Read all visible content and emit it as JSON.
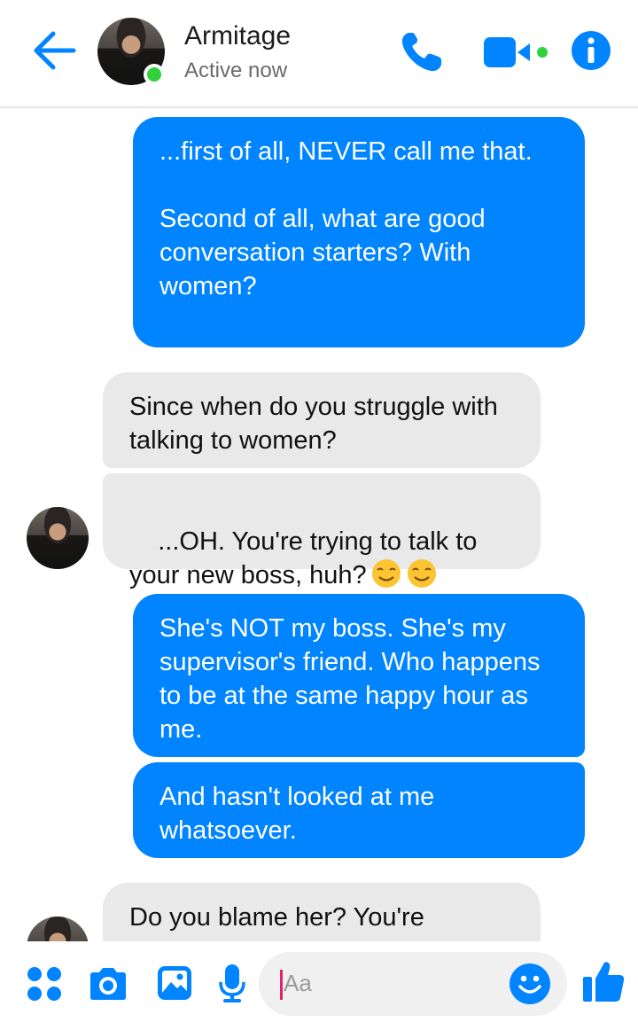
{
  "header": {
    "name": "Armitage",
    "status": "Active now"
  },
  "messages": [
    {
      "side": "out",
      "text": "...first of all, NEVER call me that.\n\nSecond of all, what are good conversation starters? With women?"
    },
    {
      "side": "in",
      "text": "Since when do you struggle with talking to women?"
    },
    {
      "side": "in",
      "text": "...OH. You're trying to talk to your new boss, huh?"
    },
    {
      "side": "out",
      "text": "She's NOT my boss. She's my supervisor's friend. Who happens to be at the same happy hour as me."
    },
    {
      "side": "out",
      "text": "And hasn't looked at me whatsoever."
    },
    {
      "side": "in",
      "text": "Do you blame her? You're"
    }
  ],
  "composer": {
    "placeholder": "Aa"
  },
  "colors": {
    "accent": "#0084ff",
    "outgoing_bubble": "#0084ff",
    "incoming_bubble": "#e9e9e9",
    "online": "#2fd13c"
  },
  "icons": {
    "back": "arrow-left-icon",
    "call": "phone-icon",
    "video": "video-camera-icon",
    "info": "info-icon",
    "apps": "grid-dots-icon",
    "camera": "camera-icon",
    "gallery": "image-icon",
    "voice": "microphone-icon",
    "emoji": "smiley-icon",
    "like": "thumbs-up-icon"
  }
}
